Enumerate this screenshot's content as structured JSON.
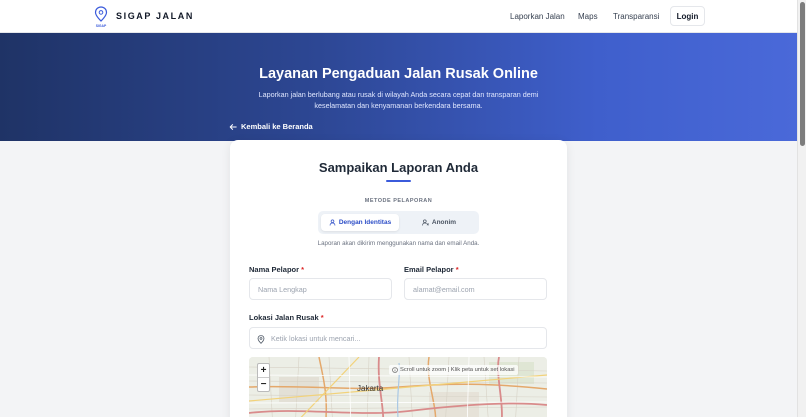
{
  "navbar": {
    "logo_text": "SIGAP",
    "brand": "SIGAP JALAN",
    "links": [
      "Laporkan Jalan",
      "Maps",
      "Transparansi"
    ],
    "login_label": "Login"
  },
  "hero": {
    "title": "Layanan Pengaduan Jalan Rusak Online",
    "subtitle": "Laporkan jalan berlubang atau rusak di wilayah Anda secara cepat dan transparan demi keselamatan dan kenyamanan berkendara bersama.",
    "back_label": "Kembali ke Beranda"
  },
  "form": {
    "title": "Sampaikan Laporan Anda",
    "method_label": "METODE PELAPORAN",
    "methods": [
      {
        "label": "Dengan Identitas",
        "icon": "user-icon",
        "active": true
      },
      {
        "label": "Anonim",
        "icon": "user-x-icon",
        "active": false
      }
    ],
    "method_desc": "Laporan akan dikirim menggunakan nama dan email Anda.",
    "name_label": "Nama Pelapor",
    "name_placeholder": "Nama Lengkap",
    "email_label": "Email Pelapor",
    "email_placeholder": "alamat@email.com",
    "location_label": "Lokasi Jalan Rusak",
    "location_placeholder": "Ketik lokasi untuk mencari...",
    "required_mark": "*"
  },
  "map": {
    "zoom_in": "+",
    "zoom_out": "−",
    "hint": "Scroll untuk zoom | Klik peta untuk set lokasi",
    "city_label": "Jakarta"
  },
  "colors": {
    "accent": "#3b5bdb",
    "hero_start": "#1f3366",
    "hero_end": "#4a69d9",
    "required": "#dc2626"
  }
}
